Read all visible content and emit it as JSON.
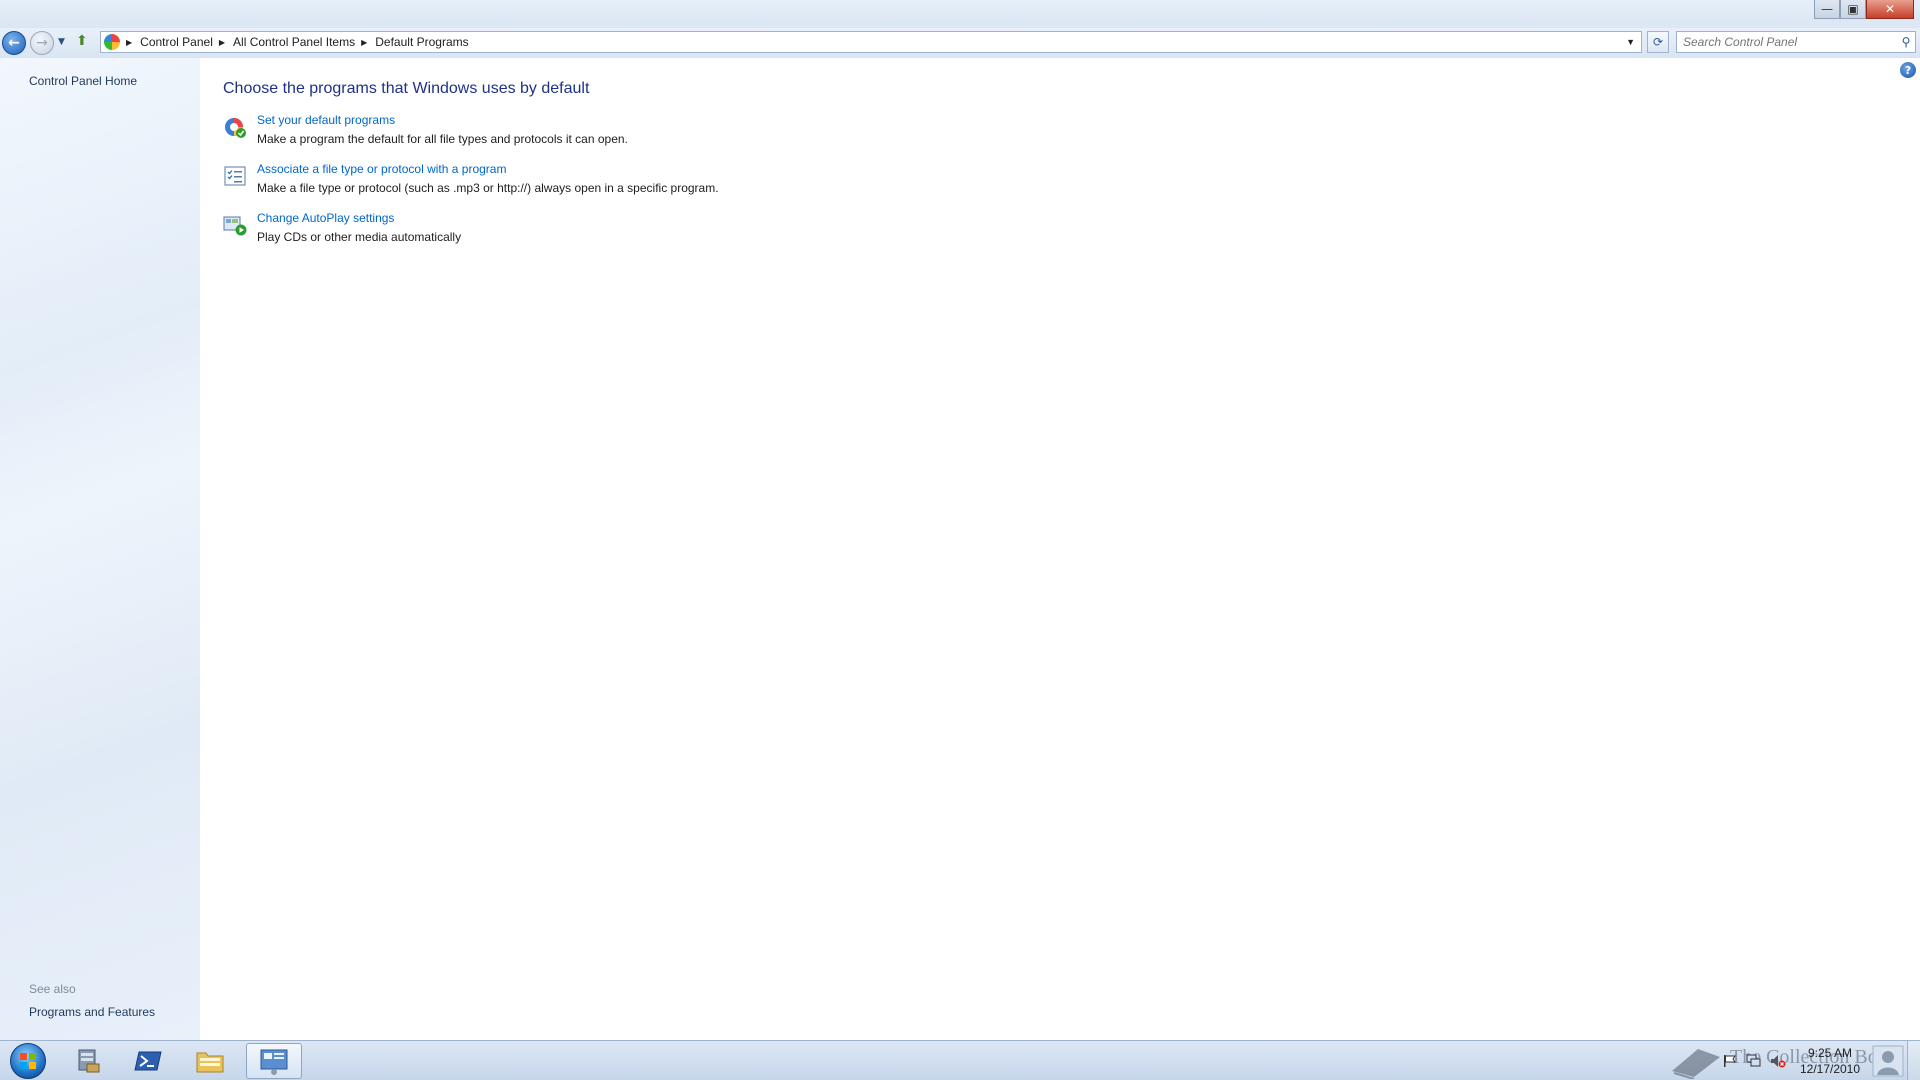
{
  "window": {
    "controls": {
      "minimize": "—",
      "maximize": "▣",
      "close": "✕"
    }
  },
  "nav": {
    "back_label": "←",
    "breadcrumb": [
      "Control Panel",
      "All Control Panel Items",
      "Default Programs"
    ],
    "search_placeholder": "Search Control Panel"
  },
  "sidebar": {
    "home_link": "Control Panel Home",
    "see_also_heading": "See also",
    "see_also_items": [
      "Programs and Features"
    ]
  },
  "main": {
    "title": "Choose the programs that Windows uses by default",
    "tasks": [
      {
        "link": "Set your default programs",
        "desc": "Make a program the default for all file types and protocols it can open.",
        "icon": "default-programs-icon"
      },
      {
        "link": "Associate a file type or protocol with a program",
        "desc": "Make a file type or protocol (such as .mp3 or http://) always open in a specific program.",
        "icon": "file-association-icon"
      },
      {
        "link": "Change AutoPlay settings",
        "desc": "Play CDs or other media automatically",
        "icon": "autoplay-icon"
      }
    ]
  },
  "taskbar": {
    "time": "9:25 AM",
    "date": "12/17/2010",
    "watermark": "The Collection Book"
  },
  "colors": {
    "link": "#0066cc",
    "title": "#1e3287",
    "sidebar_bg": "#e6eff9",
    "close_red": "#c7402a"
  }
}
